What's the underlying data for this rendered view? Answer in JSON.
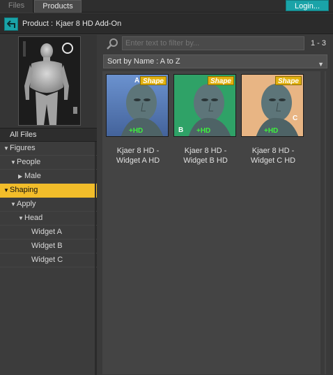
{
  "tabs": [
    {
      "label": "Files",
      "active": false
    },
    {
      "label": "Products",
      "active": true
    }
  ],
  "login_label": "Login...",
  "product_header": {
    "prefix": "Product :",
    "name": "Kjaer 8 HD Add-On"
  },
  "left": {
    "all_files": "All Files",
    "tree": [
      {
        "label": "Figures",
        "expanded": true
      },
      {
        "label": "People",
        "expanded": true
      },
      {
        "label": "Male",
        "expanded": false
      },
      {
        "label": "Shaping",
        "expanded": true,
        "selected": true
      },
      {
        "label": "Apply",
        "expanded": true
      },
      {
        "label": "Head",
        "expanded": true
      },
      {
        "label": "Widget A"
      },
      {
        "label": "Widget B"
      },
      {
        "label": "Widget C"
      }
    ]
  },
  "filter": {
    "placeholder": "Enter text to filter by...",
    "count": "1 - 3"
  },
  "sort": {
    "label": "Sort by Name : A to Z"
  },
  "products": [
    {
      "title_line1": "Kjaer 8 HD -",
      "title_line2": "Widget A HD",
      "letter": "A",
      "badge": "Shape",
      "hd": "+HD",
      "bg": "#5c84c4"
    },
    {
      "title_line1": "Kjaer 8 HD -",
      "title_line2": "Widget B HD",
      "letter": "B",
      "badge": "Shape",
      "hd": "+HD",
      "bg": "#2fa267"
    },
    {
      "title_line1": "Kjaer 8 HD -",
      "title_line2": "Widget C HD",
      "letter": "C",
      "badge": "Shape",
      "hd": "+HD",
      "bg": "#e8b584"
    }
  ],
  "colors": {
    "accent": "#1aa3a8",
    "selection": "#f2bd2a",
    "hd_green": "#3df23d",
    "badge_yellow": "#e2b10f"
  }
}
